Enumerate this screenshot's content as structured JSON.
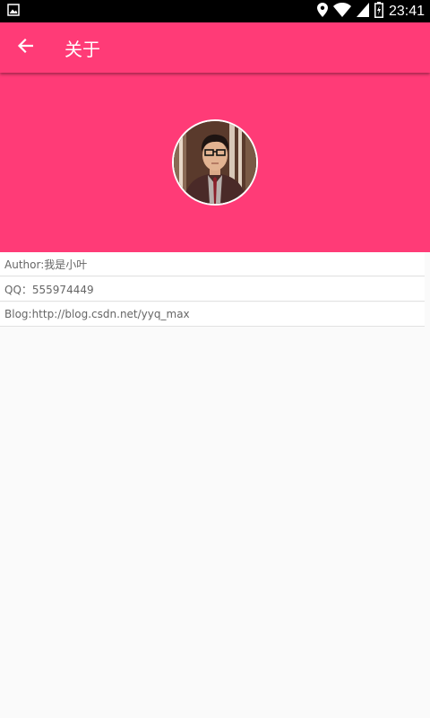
{
  "status_bar": {
    "time": "23:41",
    "icons": [
      "image-icon",
      "location-icon",
      "wifi-icon",
      "signal-icon",
      "battery-icon"
    ]
  },
  "app_bar": {
    "title": "关于",
    "back_icon": "arrow-left-icon",
    "color": "#ff3b77"
  },
  "header": {
    "avatar": "avatar-photo"
  },
  "info": [
    {
      "label": "Author:我是小叶"
    },
    {
      "label": "QQ：555974449"
    },
    {
      "label": "Blog:http://blog.csdn.net/yyq_max"
    }
  ]
}
